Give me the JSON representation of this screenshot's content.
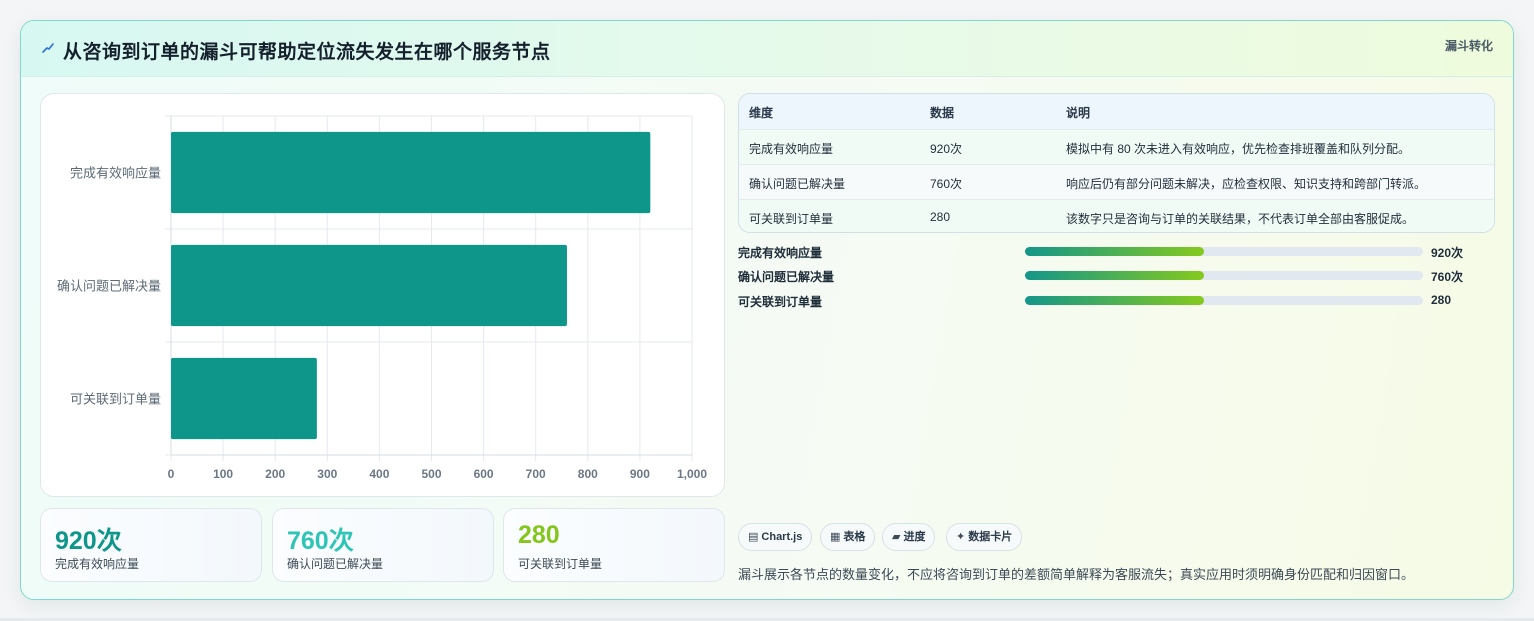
{
  "header": {
    "title": "从咨询到订单的漏斗可帮助定位流失发生在哪个服务节点",
    "tag": "漏斗转化",
    "icon": "lightning-icon"
  },
  "colors": {
    "bar": "#0f968a",
    "stat_primary": "#0f968a",
    "stat_secondary": "#2ec4b6",
    "stat_tertiary": "#84c61b",
    "progress_start": "#13968a",
    "progress_end": "#86c91e"
  },
  "chart_data": {
    "type": "bar",
    "orientation": "horizontal",
    "categories": [
      "完成有效响应量",
      "确认问题已解决量",
      "可关联到订单量"
    ],
    "values": [
      920,
      760,
      280
    ],
    "xlim": [
      0,
      1000
    ],
    "xticks": [
      "0",
      "100",
      "200",
      "300",
      "400",
      "500",
      "600",
      "700",
      "800",
      "900",
      "1,000"
    ],
    "grid": true,
    "legend": "none"
  },
  "stats": [
    {
      "value": "920次",
      "label": "完成有效响应量"
    },
    {
      "value": "760次",
      "label": "确认问题已解决量"
    },
    {
      "value": "280",
      "label": "可关联到订单量"
    }
  ],
  "table": {
    "headers": [
      "维度",
      "数据",
      "说明"
    ],
    "rows": [
      [
        "完成有效响应量",
        "920次",
        "模拟中有 80 次未进入有效响应，优先检查排班覆盖和队列分配。"
      ],
      [
        "确认问题已解决量",
        "760次",
        "响应后仍有部分问题未解决，应检查权限、知识支持和跨部门转派。"
      ],
      [
        "可关联到订单量",
        "280",
        "该数字只是咨询与订单的关联结果，不代表订单全部由客服促成。"
      ]
    ]
  },
  "progress": [
    {
      "label": "完成有效响应量",
      "value": "920次",
      "fill_fraction": 0.45
    },
    {
      "label": "确认问题已解决量",
      "value": "760次",
      "fill_fraction": 0.45
    },
    {
      "label": "可关联到订单量",
      "value": "280",
      "fill_fraction": 0.45
    }
  ],
  "chips": [
    {
      "icon": "chart-icon",
      "glyph": "▤",
      "label": "Chart.js"
    },
    {
      "icon": "table-icon",
      "glyph": "▦",
      "label": "表格"
    },
    {
      "icon": "progress-icon",
      "glyph": "▰",
      "label": "进度"
    },
    {
      "icon": "sparkle-icon",
      "glyph": "✦",
      "label": "数据卡片"
    }
  ],
  "footnote": "漏斗展示各节点的数量变化，不应将咨询到订单的差额简单解释为客服流失；真实应用时须明确身份匹配和归因窗口。"
}
